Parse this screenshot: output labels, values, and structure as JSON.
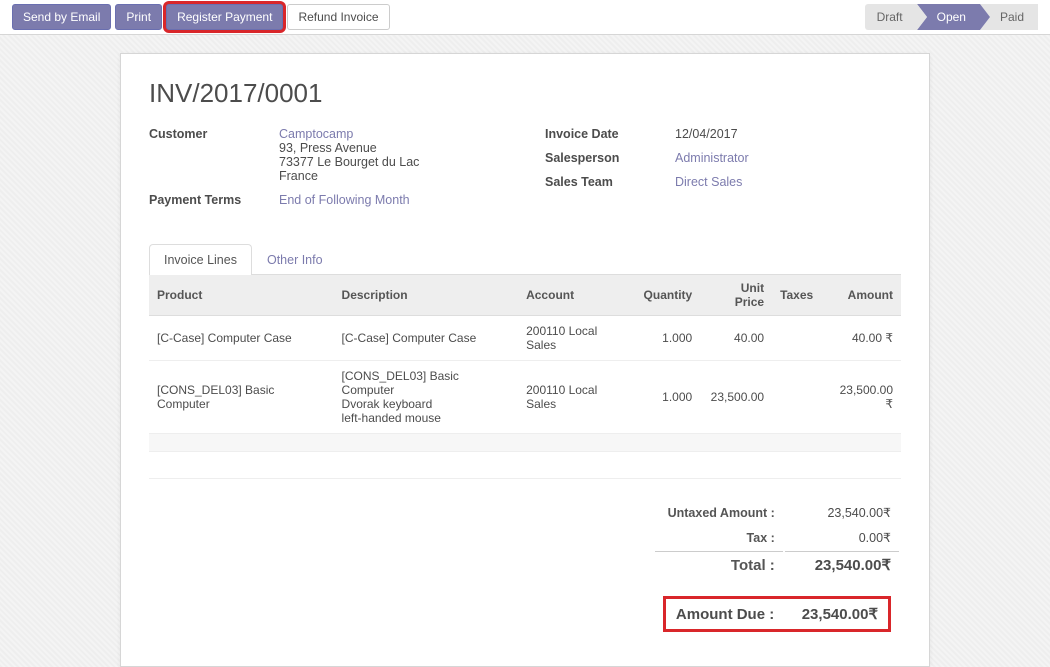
{
  "toolbar": {
    "send_email": "Send by Email",
    "print": "Print",
    "register_payment": "Register Payment",
    "refund_invoice": "Refund Invoice"
  },
  "status": {
    "draft": "Draft",
    "open": "Open",
    "paid": "Paid"
  },
  "title": "INV/2017/0001",
  "left_fields": {
    "customer_label": "Customer",
    "customer_name": "Camptocamp",
    "customer_addr": "93, Press Avenue\n73377 Le Bourget du Lac\nFrance",
    "payment_terms_label": "Payment Terms",
    "payment_terms": "End of Following Month"
  },
  "right_fields": {
    "invoice_date_label": "Invoice Date",
    "invoice_date": "12/04/2017",
    "salesperson_label": "Salesperson",
    "salesperson": "Administrator",
    "sales_team_label": "Sales Team",
    "sales_team": "Direct Sales"
  },
  "tabs": {
    "invoice_lines": "Invoice Lines",
    "other_info": "Other Info"
  },
  "table": {
    "headers": {
      "product": "Product",
      "description": "Description",
      "account": "Account",
      "quantity": "Quantity",
      "unit_price": "Unit Price",
      "taxes": "Taxes",
      "amount": "Amount"
    },
    "rows": [
      {
        "product": "[C-Case] Computer Case",
        "description": "[C-Case] Computer Case",
        "account": "200110 Local Sales",
        "quantity": "1.000",
        "unit_price": "40.00",
        "taxes": "",
        "amount": "40.00 ₹"
      },
      {
        "product": "[CONS_DEL03] Basic Computer",
        "description": "[CONS_DEL03] Basic Computer\nDvorak keyboard\nleft-handed mouse",
        "account": "200110 Local Sales",
        "quantity": "1.000",
        "unit_price": "23,500.00",
        "taxes": "",
        "amount": "23,500.00 ₹"
      }
    ]
  },
  "totals": {
    "untaxed_label": "Untaxed Amount :",
    "untaxed": "23,540.00₹",
    "tax_label": "Tax :",
    "tax": "0.00₹",
    "total_label": "Total :",
    "total": "23,540.00₹",
    "amount_due_label": "Amount Due :",
    "amount_due": "23,540.00₹"
  }
}
